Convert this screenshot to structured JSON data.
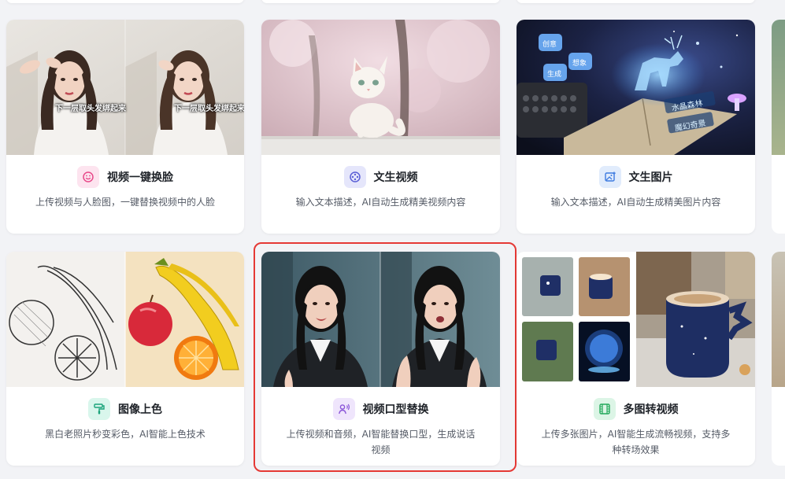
{
  "cards": [
    {
      "title": "视频一键换脸",
      "description": "上传视频与人脸图，一键替换视频中的人脸",
      "icon": "smile-face-icon",
      "icon_color": "#e84a8a",
      "icon_bg": "#fde4ef",
      "thumb_caption": "下一层取头发绑起来"
    },
    {
      "title": "文生视频",
      "description": "输入文本描述，AI自动生成精美视频内容",
      "icon": "film-reel-icon",
      "icon_color": "#5b5fd6",
      "icon_bg": "#e5e6fb"
    },
    {
      "title": "文生图片",
      "description": "输入文本描述，AI自动生成精美图片内容",
      "icon": "image-plus-icon",
      "icon_color": "#3d7be0",
      "icon_bg": "#e1ecfc",
      "thumb_labels": [
        "创意",
        "想象",
        "生成",
        "水晶森林",
        "魔幻奇景"
      ]
    },
    {
      "title": "图像上色",
      "description": "黑白老照片秒变彩色，AI智能上色技术",
      "icon": "paint-roller-icon",
      "icon_color": "#1aa37a",
      "icon_bg": "#d9f6ec"
    },
    {
      "title": "视频口型替换",
      "description": "上传视频和音频，AI智能替换口型，生成说话视频",
      "icon": "person-voice-icon",
      "icon_color": "#8a55d8",
      "icon_bg": "#efe5fc",
      "selected": true
    },
    {
      "title": "多图转视频",
      "description": "上传多张图片，AI智能生成流畅视频，支持多种转场效果",
      "icon": "film-strip-icon",
      "icon_color": "#22a95a",
      "icon_bg": "#dcf5e6"
    }
  ],
  "selection_color": "#e53935"
}
